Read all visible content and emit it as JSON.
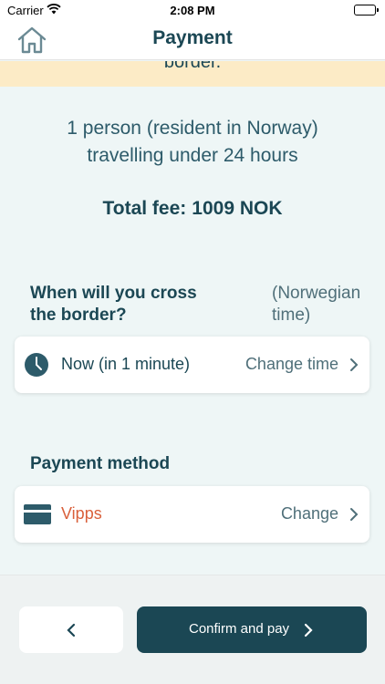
{
  "status_bar": {
    "carrier": "Carrier",
    "time": "2:08 PM"
  },
  "nav": {
    "title": "Payment",
    "home_icon": "home-icon"
  },
  "banner": {
    "text": "border."
  },
  "summary": {
    "line1": "1 person (resident in Norway)",
    "line2": "travelling under 24 hours"
  },
  "fee": {
    "label": "Total fee:",
    "amount": "1009 NOK"
  },
  "crossing": {
    "title": "When will you cross the border?",
    "note": "(Norwegian time)",
    "value": "Now (in 1 minute)",
    "action": "Change time",
    "icon": "clock-icon"
  },
  "payment": {
    "title": "Payment method",
    "value": "Vipps",
    "action": "Change",
    "icon": "card-icon",
    "value_color": "#d9603b"
  },
  "footer": {
    "confirm_label": "Confirm and pay",
    "back_icon": "chevron-left-icon"
  },
  "colors": {
    "primary": "#1b4754",
    "background": "#eef6f6",
    "banner": "#fcebc6"
  }
}
